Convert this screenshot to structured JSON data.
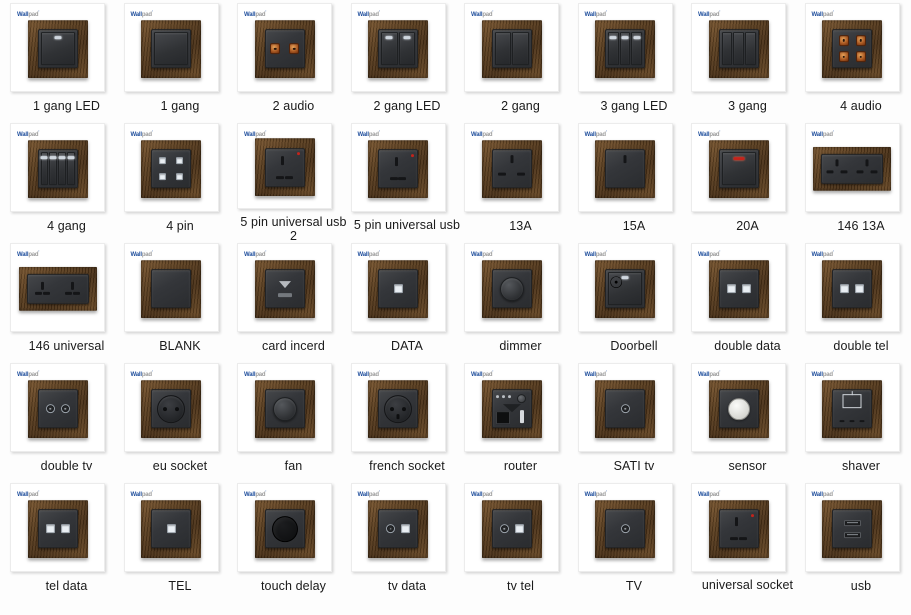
{
  "page": {
    "title": "Wallpad wall switch and socket product catalog grid",
    "background_color": "#fdfdfd",
    "columns": 8,
    "rows": 5
  },
  "brand": {
    "name": "Wallpad",
    "part_blue": "Wall",
    "part_grey": "pad",
    "trademark": "'",
    "blue_hex": "#1f4e9c",
    "grey_hex": "#9a9a9a"
  },
  "palette": {
    "wood_light": "#7b5730",
    "wood_dark": "#4a3117",
    "plate_dark": "#2a2c2f",
    "led_white": "#cfd6de",
    "led_red": "#c3241c",
    "card_bg": "#ffffff",
    "label_text": "#1a1a1a"
  },
  "products": [
    {
      "label": "1 gang LED",
      "style": "sq",
      "face": "gang",
      "gangs": 1,
      "led": "white"
    },
    {
      "label": "1 gang",
      "style": "sq",
      "face": "gang",
      "gangs": 1,
      "led": "none"
    },
    {
      "label": "2 audio",
      "style": "sq",
      "face": "audio2",
      "gangs": 0,
      "led": "none"
    },
    {
      "label": "2 gang LED",
      "style": "sq",
      "face": "gang",
      "gangs": 2,
      "led": "white"
    },
    {
      "label": "2 gang",
      "style": "sq",
      "face": "gang",
      "gangs": 2,
      "led": "none"
    },
    {
      "label": "3 gang LED",
      "style": "sq",
      "face": "gang",
      "gangs": 3,
      "led": "white"
    },
    {
      "label": "3 gang",
      "style": "sq",
      "face": "gang",
      "gangs": 3,
      "led": "none"
    },
    {
      "label": "4 audio",
      "style": "sq",
      "face": "audio4",
      "gangs": 0,
      "led": "none"
    },
    {
      "label": "4 gang",
      "style": "sq",
      "face": "gang",
      "gangs": 4,
      "led": "white"
    },
    {
      "label": "4 pin",
      "style": "sq",
      "face": "pin4",
      "gangs": 0,
      "led": "none"
    },
    {
      "label": "5 pin universal usb 2",
      "style": "sq",
      "face": "uniusb",
      "gangs": 0,
      "led": "none"
    },
    {
      "label": "5 pin universal usb",
      "style": "sq",
      "face": "uniusb",
      "gangs": 0,
      "led": "none"
    },
    {
      "label": "13A",
      "style": "sq",
      "face": "uk13a",
      "gangs": 0,
      "led": "none"
    },
    {
      "label": "15A",
      "style": "sq",
      "face": "uk15a",
      "gangs": 0,
      "led": "none"
    },
    {
      "label": "20A",
      "style": "sq",
      "face": "gang",
      "gangs": 1,
      "led": "red"
    },
    {
      "label": "146 13A",
      "style": "wd",
      "face": "dual13a",
      "gangs": 0,
      "led": "none"
    },
    {
      "label": "146 universal",
      "style": "wd",
      "face": "dualuni",
      "gangs": 0,
      "led": "none"
    },
    {
      "label": "BLANK",
      "style": "sq",
      "face": "blank",
      "gangs": 0,
      "led": "none"
    },
    {
      "label": "card incerd",
      "style": "sq",
      "face": "card",
      "gangs": 0,
      "led": "none"
    },
    {
      "label": "DATA",
      "style": "sq",
      "face": "jack1",
      "gangs": 0,
      "led": "none"
    },
    {
      "label": "dimmer",
      "style": "sq",
      "face": "dimmer",
      "gangs": 0,
      "led": "none"
    },
    {
      "label": "Doorbell",
      "style": "sq",
      "face": "doorbell",
      "gangs": 1,
      "led": "white"
    },
    {
      "label": "double data",
      "style": "sq",
      "face": "jack2",
      "gangs": 0,
      "led": "none"
    },
    {
      "label": "double tel",
      "style": "sq",
      "face": "jack2",
      "gangs": 0,
      "led": "none"
    },
    {
      "label": "double tv",
      "style": "sq",
      "face": "coax2",
      "gangs": 0,
      "led": "none"
    },
    {
      "label": "eu socket",
      "style": "sq",
      "face": "eu",
      "gangs": 0,
      "led": "none"
    },
    {
      "label": "fan",
      "style": "sq",
      "face": "fan",
      "gangs": 0,
      "led": "none"
    },
    {
      "label": "french socket",
      "style": "sq",
      "face": "french",
      "gangs": 0,
      "led": "none"
    },
    {
      "label": "router",
      "style": "sq",
      "face": "router",
      "gangs": 0,
      "led": "none"
    },
    {
      "label": "SATI tv",
      "style": "sq",
      "face": "coax1",
      "gangs": 0,
      "led": "none"
    },
    {
      "label": "sensor",
      "style": "sq",
      "face": "sensor",
      "gangs": 0,
      "led": "none"
    },
    {
      "label": "shaver",
      "style": "sq",
      "face": "shaver",
      "gangs": 0,
      "led": "none"
    },
    {
      "label": "tel data",
      "style": "sq",
      "face": "jack2",
      "gangs": 0,
      "led": "none"
    },
    {
      "label": "TEL",
      "style": "sq",
      "face": "jack1",
      "gangs": 0,
      "led": "none"
    },
    {
      "label": "touch delay",
      "style": "sq",
      "face": "touch",
      "gangs": 0,
      "led": "none"
    },
    {
      "label": "tv data",
      "style": "sq",
      "face": "coaxjack",
      "gangs": 0,
      "led": "none"
    },
    {
      "label": "tv tel",
      "style": "sq",
      "face": "coaxjack",
      "gangs": 0,
      "led": "none"
    },
    {
      "label": "TV",
      "style": "sq",
      "face": "coax1",
      "gangs": 0,
      "led": "none"
    },
    {
      "label": "universal socket",
      "style": "sq",
      "face": "universal",
      "gangs": 0,
      "led": "none"
    },
    {
      "label": "usb",
      "style": "sq",
      "face": "usb2",
      "gangs": 0,
      "led": "none"
    }
  ]
}
